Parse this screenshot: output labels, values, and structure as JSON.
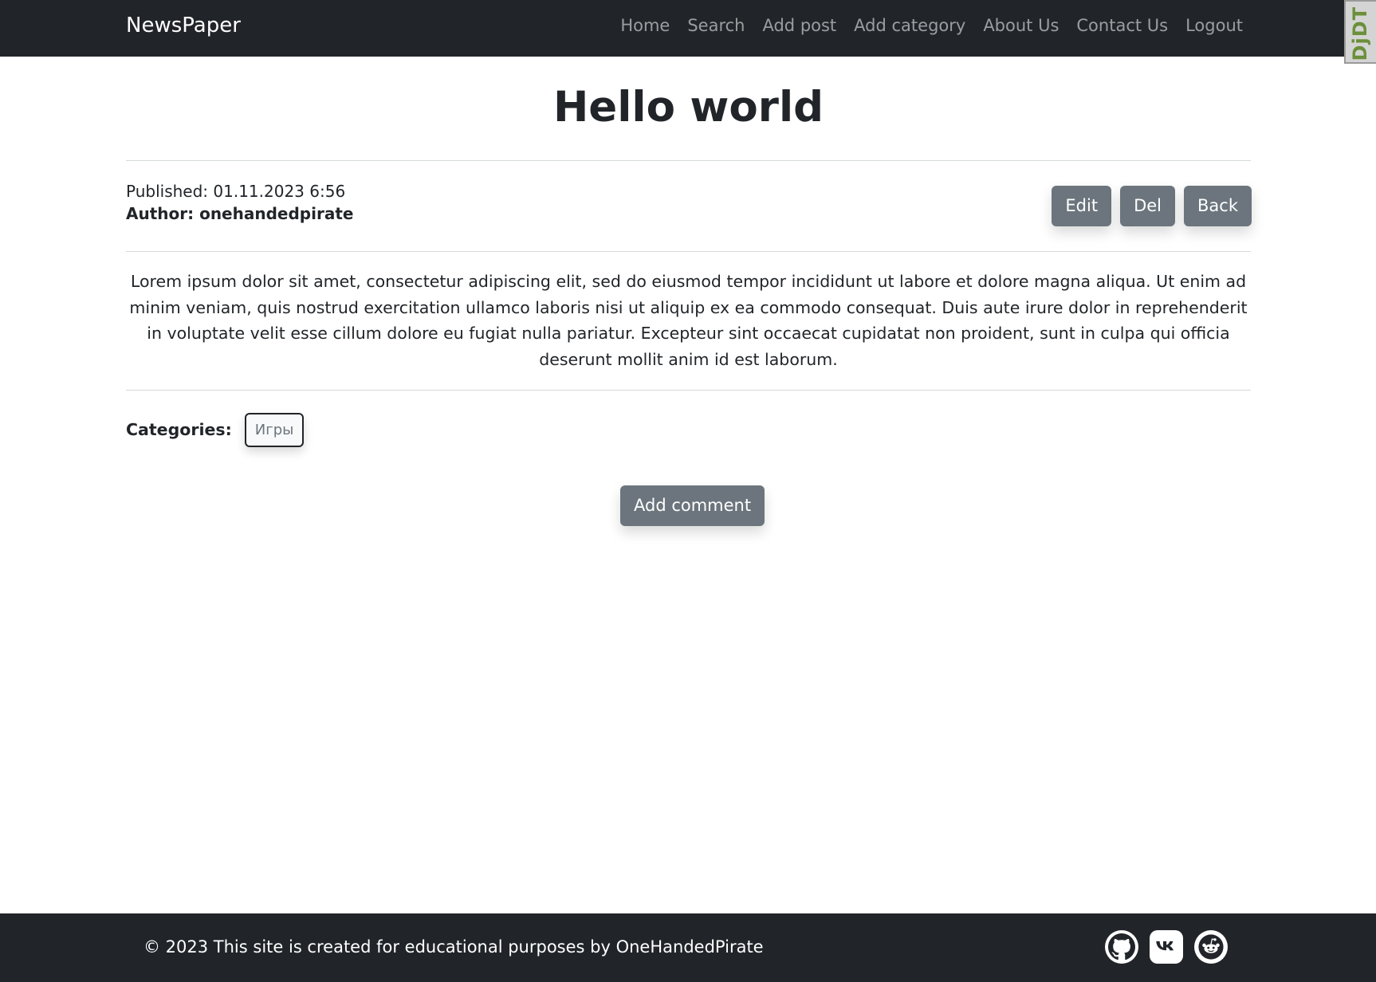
{
  "navbar": {
    "brand": "NewsPaper",
    "links": [
      "Home",
      "Search",
      "Add post",
      "Add category",
      "About Us",
      "Contact Us",
      "Logout"
    ]
  },
  "debug_toolbar": {
    "label": "DjDT"
  },
  "post": {
    "title": "Hello world",
    "published": "Published: 01.11.2023 6:56",
    "author": "Author: onehandedpirate",
    "body": "Lorem ipsum dolor sit amet, consectetur adipiscing elit, sed do eiusmod tempor incididunt ut labore et dolore magna aliqua. Ut enim ad minim veniam, quis nostrud exercitation ullamco laboris nisi ut aliquip ex ea commodo consequat. Duis aute irure dolor in reprehenderit in voluptate velit esse cillum dolore eu fugiat nulla pariatur. Excepteur sint occaecat cupidatat non proident, sunt in culpa qui officia deserunt mollit anim id est laborum."
  },
  "actions": {
    "edit": "Edit",
    "del": "Del",
    "back": "Back"
  },
  "categories": {
    "label": "Categories:",
    "items": [
      "Игры"
    ]
  },
  "add_comment": "Add comment",
  "footer": {
    "text": "© 2023 This site is created for educational purposes by OneHandedPirate",
    "social": [
      "github-icon",
      "vk-icon",
      "reddit-icon"
    ]
  },
  "colors": {
    "navbar_bg": "#212529",
    "button_bg": "#6c757d",
    "text": "#212529"
  }
}
